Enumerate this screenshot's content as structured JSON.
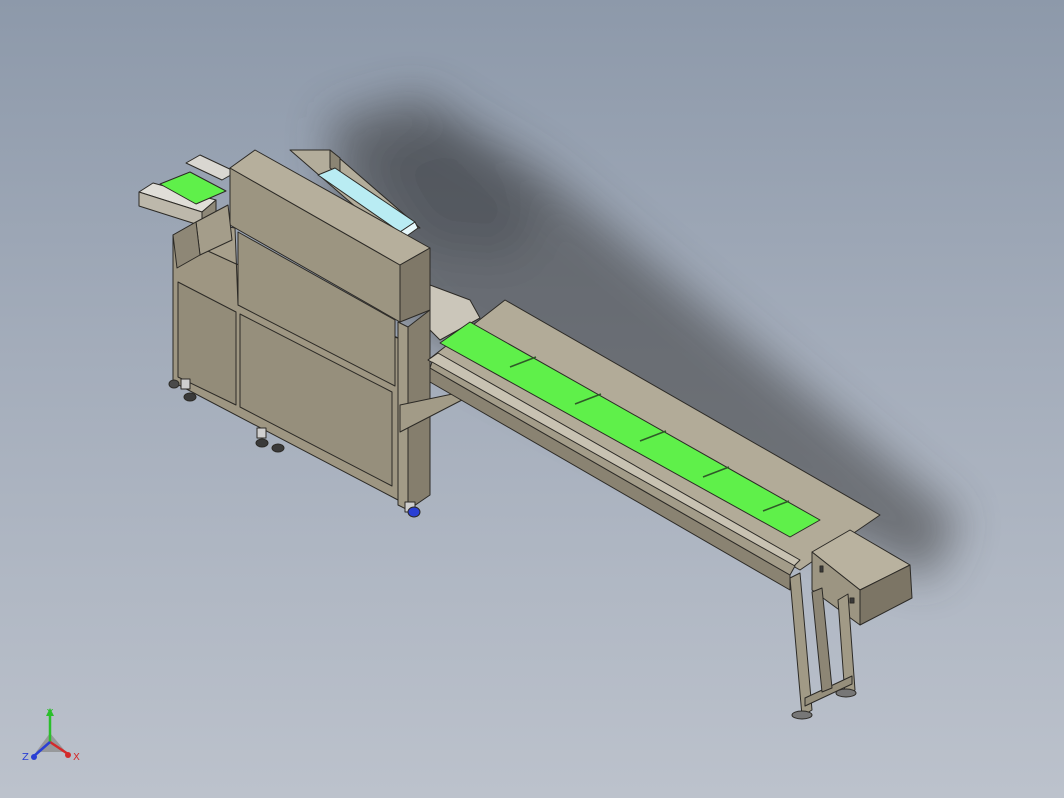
{
  "triad": {
    "x_label": "X",
    "y_label": "Y",
    "z_label": "Z",
    "x_color": "#d42a2a",
    "y_color": "#2bbf2b",
    "z_color": "#2a3fd4"
  },
  "colors": {
    "frame": "#9e9682",
    "frame_dark": "#7f7868",
    "frame_light": "#b3ad9b",
    "belt": "#5ff04a",
    "edge": "#2c2a26",
    "cyan_panel": "#b9ecf3"
  }
}
